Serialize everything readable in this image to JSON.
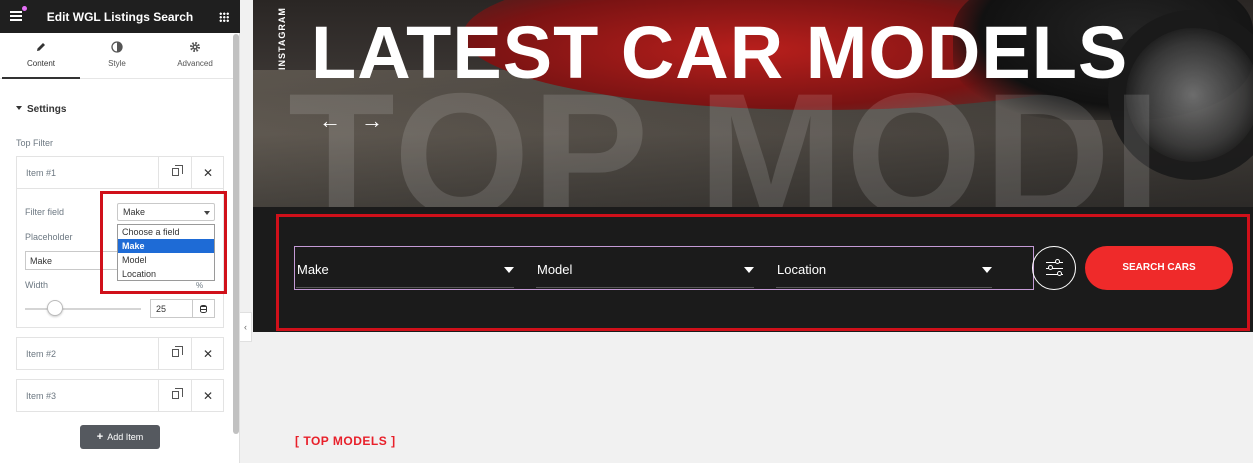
{
  "panel": {
    "title": "Edit WGL Listings Search",
    "tabs": [
      {
        "label": "Content",
        "icon": "pencil-icon",
        "active": true
      },
      {
        "label": "Style",
        "icon": "half-circle-icon",
        "active": false
      },
      {
        "label": "Advanced",
        "icon": "gear-icon",
        "active": false
      }
    ],
    "section_title": "Settings",
    "top_filter_label": "Top Filter",
    "items": [
      {
        "title": "Item #1"
      },
      {
        "title": "Item #2"
      },
      {
        "title": "Item #3"
      }
    ],
    "filter_field_label": "Filter field",
    "filter_field_value": "Make",
    "filter_options": [
      "Choose a field",
      "Make",
      "Model",
      "Location"
    ],
    "filter_selected": "Make",
    "placeholder_label": "Placeholder",
    "placeholder_value": "Make",
    "width_label": "Width",
    "width_unit": "%",
    "width_value": "25",
    "add_item_label": "Add Item",
    "collapse_glyph": "‹"
  },
  "preview": {
    "side_label": "INSTAGRAM",
    "title": "LATEST CAR MODELS",
    "watermark": "TOP MODI",
    "prev_arrow": "←",
    "next_arrow": "→",
    "search": {
      "fields": [
        {
          "label": "Make"
        },
        {
          "label": "Model"
        },
        {
          "label": "Location"
        }
      ],
      "button_label": "SEARCH CARS"
    },
    "top_models_label": "[ TOP MODELS ]"
  },
  "colors": {
    "accent_red": "#ef2a2a",
    "highlight_box": "#d0101a",
    "dropdown_selected": "#1e6bd6",
    "panel_header": "#1f1f1f",
    "search_bar": "#1b1b1b"
  }
}
